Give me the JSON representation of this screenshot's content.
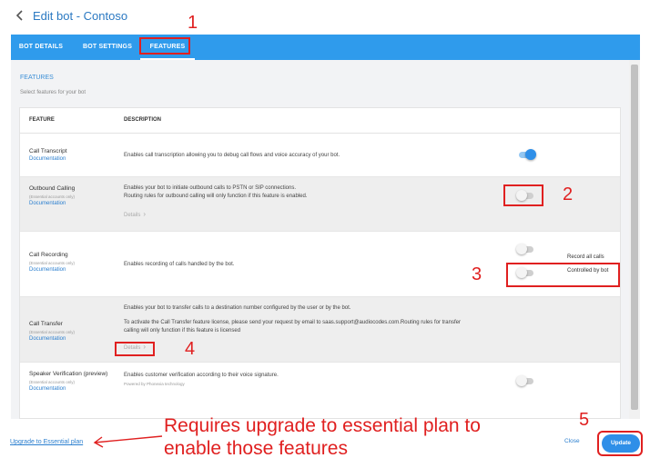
{
  "header": {
    "title": "Edit bot - Contoso"
  },
  "tabs": [
    {
      "label": "BOT DETAILS"
    },
    {
      "label": "BOT SETTINGS"
    },
    {
      "label": "FEATURES"
    }
  ],
  "section": {
    "title": "FEATURES",
    "subtitle": "Select features for your bot"
  },
  "table": {
    "col_feature": "FEATURE",
    "col_description": "DESCRIPTION"
  },
  "features": [
    {
      "name": "Call Transcript",
      "doc": "Documentation",
      "desc1": "Enables call transcription allowing you to debug call flows and voice accuracy of your bot.",
      "toggle_on": true
    },
    {
      "name": "Outbound Calling",
      "note": "(Essential accounts only)",
      "doc": "Documentation",
      "desc1": "Enables your bot to initiate outbound calls to PSTN or SIP connections.",
      "desc2": "Routing rules for outbound calling will only function if this feature is enabled.",
      "details": "Details",
      "toggle_on": false
    },
    {
      "name": "Call Recording",
      "note": "(Essential accounts only)",
      "doc": "Documentation",
      "desc1": "Enables recording of calls handled by the bot.",
      "option1": "Record all calls",
      "option2": "Controlled by bot"
    },
    {
      "name": "Call Transfer",
      "note": "(Essential accounts only)",
      "doc": "Documentation",
      "desc1": "Enables your bot to transfer calls to a destination number configured by the user or by the bot.",
      "desc2": "To activate the Call Transfer feature license, please send your request by email to saas.support@audiocodes.com.Routing rules for transfer",
      "desc3": "calling will only function if this feature is licensed",
      "details": "Details"
    },
    {
      "name": "Speaker Verification (preview)",
      "note": "(Essential accounts only)",
      "doc": "Documentation",
      "desc1": "Enables customer verification according to their voice signature.",
      "desc_small": "Powered by Phonexia technology",
      "toggle_on": false
    }
  ],
  "footer": {
    "upgrade_link": "Upgrade to Essential plan",
    "close": "Close",
    "update": "Update"
  },
  "annotations": {
    "n1": "1",
    "n2": "2",
    "n3": "3",
    "n4": "4",
    "n5": "5",
    "text_line1": "Requires upgrade to essential plan to",
    "text_line2": "enable those features"
  },
  "colors": {
    "accent": "#2f9bec",
    "annotation": "#e02020",
    "link": "#2b7fcf"
  }
}
